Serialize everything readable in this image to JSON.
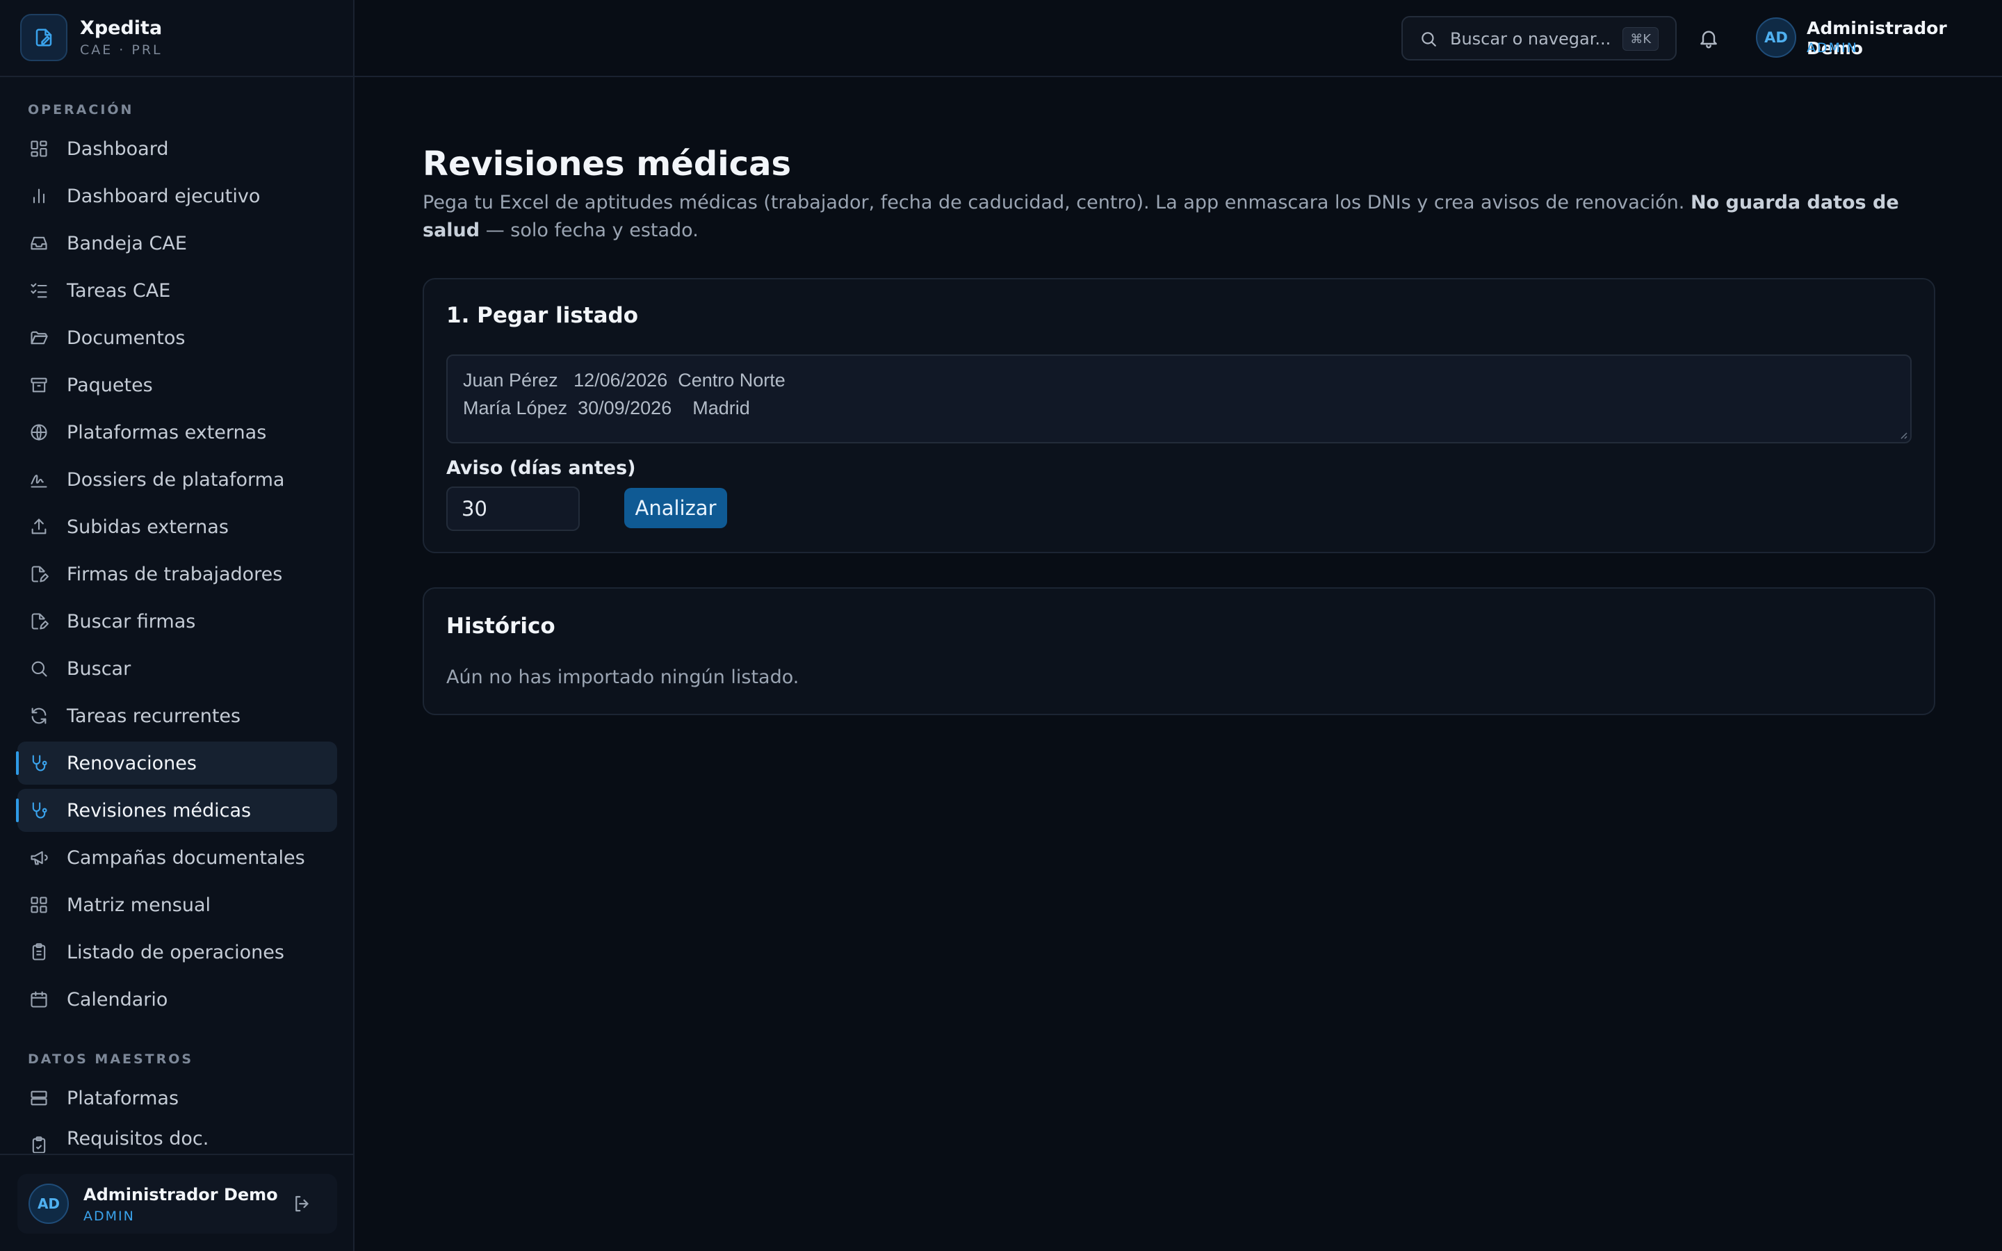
{
  "brand": {
    "name": "Xpedita",
    "subtitle": "CAE · PRL"
  },
  "sidebar": {
    "section_operacion": "OPERACIÓN",
    "section_datos": "DATOS MAESTROS",
    "items": [
      {
        "label": "Dashboard",
        "icon": "dashboard-icon"
      },
      {
        "label": "Dashboard ejecutivo",
        "icon": "bar-chart-icon"
      },
      {
        "label": "Bandeja CAE",
        "icon": "inbox-icon"
      },
      {
        "label": "Tareas CAE",
        "icon": "tasks-list-icon"
      },
      {
        "label": "Documentos",
        "icon": "folder-open-icon"
      },
      {
        "label": "Paquetes",
        "icon": "archive-icon"
      },
      {
        "label": "Plataformas externas",
        "icon": "globe-icon"
      },
      {
        "label": "Dossiers de plataforma",
        "icon": "signature-icon"
      },
      {
        "label": "Subidas externas",
        "icon": "upload-icon"
      },
      {
        "label": "Firmas de trabajadores",
        "icon": "file-pen-icon"
      },
      {
        "label": "Buscar firmas",
        "icon": "file-pen-icon"
      },
      {
        "label": "Buscar",
        "icon": "search-icon"
      },
      {
        "label": "Tareas recurrentes",
        "icon": "refresh-icon"
      },
      {
        "label": "Renovaciones",
        "icon": "stethoscope-icon",
        "active": true
      },
      {
        "label": "Revisiones médicas",
        "icon": "stethoscope-icon",
        "active": true
      },
      {
        "label": "Campañas documentales",
        "icon": "megaphone-icon"
      },
      {
        "label": "Matriz mensual",
        "icon": "grid-icon"
      },
      {
        "label": "Listado de operaciones",
        "icon": "clipboard-list-icon"
      },
      {
        "label": "Calendario",
        "icon": "calendar-icon"
      }
    ],
    "master_items": [
      {
        "label": "Plataformas",
        "icon": "server-icon"
      },
      {
        "label": "Requisitos doc.",
        "icon": "clipboard-check-icon"
      }
    ]
  },
  "user": {
    "initials": "AD",
    "name": "Administrador Demo",
    "role": "ADMIN"
  },
  "topbar": {
    "search_placeholder": "Buscar o navegar...",
    "shortcut": "⌘K"
  },
  "page": {
    "title": "Revisiones médicas",
    "desc_pre": "Pega tu Excel de aptitudes médicas (trabajador, fecha de caducidad, centro). La app enmascara los DNIs y crea avisos de renovación. ",
    "desc_bold": "No guarda datos de salud",
    "desc_post": " — solo fecha y estado."
  },
  "import_card": {
    "title": "1. Pegar listado",
    "paste_lines": [
      "Juan Pérez   12/06/2026  Centro Norte",
      "María López  30/09/2026    Madrid"
    ],
    "days_label": "Aviso (días antes)",
    "days_value": "30",
    "analyze_label": "Analizar"
  },
  "history_card": {
    "title": "Histórico",
    "empty_text": "Aún no has importado ningún listado."
  },
  "colors": {
    "accent": "#2e9ae6",
    "background": "#080d15",
    "button": "#0f5a94"
  }
}
